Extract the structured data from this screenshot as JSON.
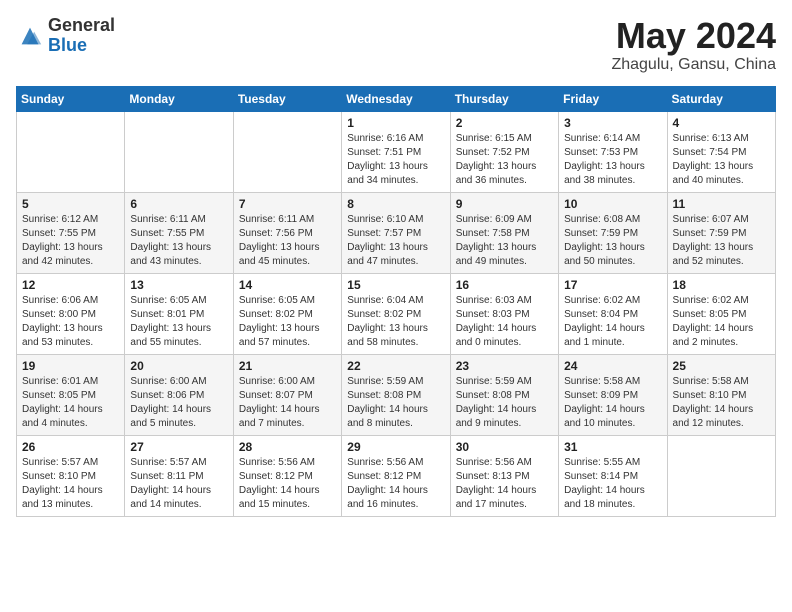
{
  "logo": {
    "general": "General",
    "blue": "Blue"
  },
  "title": {
    "month": "May 2024",
    "location": "Zhagulu, Gansu, China"
  },
  "weekdays": [
    "Sunday",
    "Monday",
    "Tuesday",
    "Wednesday",
    "Thursday",
    "Friday",
    "Saturday"
  ],
  "weeks": [
    [
      {
        "day": "",
        "info": ""
      },
      {
        "day": "",
        "info": ""
      },
      {
        "day": "",
        "info": ""
      },
      {
        "day": "1",
        "info": "Sunrise: 6:16 AM\nSunset: 7:51 PM\nDaylight: 13 hours\nand 34 minutes."
      },
      {
        "day": "2",
        "info": "Sunrise: 6:15 AM\nSunset: 7:52 PM\nDaylight: 13 hours\nand 36 minutes."
      },
      {
        "day": "3",
        "info": "Sunrise: 6:14 AM\nSunset: 7:53 PM\nDaylight: 13 hours\nand 38 minutes."
      },
      {
        "day": "4",
        "info": "Sunrise: 6:13 AM\nSunset: 7:54 PM\nDaylight: 13 hours\nand 40 minutes."
      }
    ],
    [
      {
        "day": "5",
        "info": "Sunrise: 6:12 AM\nSunset: 7:55 PM\nDaylight: 13 hours\nand 42 minutes."
      },
      {
        "day": "6",
        "info": "Sunrise: 6:11 AM\nSunset: 7:55 PM\nDaylight: 13 hours\nand 43 minutes."
      },
      {
        "day": "7",
        "info": "Sunrise: 6:11 AM\nSunset: 7:56 PM\nDaylight: 13 hours\nand 45 minutes."
      },
      {
        "day": "8",
        "info": "Sunrise: 6:10 AM\nSunset: 7:57 PM\nDaylight: 13 hours\nand 47 minutes."
      },
      {
        "day": "9",
        "info": "Sunrise: 6:09 AM\nSunset: 7:58 PM\nDaylight: 13 hours\nand 49 minutes."
      },
      {
        "day": "10",
        "info": "Sunrise: 6:08 AM\nSunset: 7:59 PM\nDaylight: 13 hours\nand 50 minutes."
      },
      {
        "day": "11",
        "info": "Sunrise: 6:07 AM\nSunset: 7:59 PM\nDaylight: 13 hours\nand 52 minutes."
      }
    ],
    [
      {
        "day": "12",
        "info": "Sunrise: 6:06 AM\nSunset: 8:00 PM\nDaylight: 13 hours\nand 53 minutes."
      },
      {
        "day": "13",
        "info": "Sunrise: 6:05 AM\nSunset: 8:01 PM\nDaylight: 13 hours\nand 55 minutes."
      },
      {
        "day": "14",
        "info": "Sunrise: 6:05 AM\nSunset: 8:02 PM\nDaylight: 13 hours\nand 57 minutes."
      },
      {
        "day": "15",
        "info": "Sunrise: 6:04 AM\nSunset: 8:02 PM\nDaylight: 13 hours\nand 58 minutes."
      },
      {
        "day": "16",
        "info": "Sunrise: 6:03 AM\nSunset: 8:03 PM\nDaylight: 14 hours\nand 0 minutes."
      },
      {
        "day": "17",
        "info": "Sunrise: 6:02 AM\nSunset: 8:04 PM\nDaylight: 14 hours\nand 1 minute."
      },
      {
        "day": "18",
        "info": "Sunrise: 6:02 AM\nSunset: 8:05 PM\nDaylight: 14 hours\nand 2 minutes."
      }
    ],
    [
      {
        "day": "19",
        "info": "Sunrise: 6:01 AM\nSunset: 8:05 PM\nDaylight: 14 hours\nand 4 minutes."
      },
      {
        "day": "20",
        "info": "Sunrise: 6:00 AM\nSunset: 8:06 PM\nDaylight: 14 hours\nand 5 minutes."
      },
      {
        "day": "21",
        "info": "Sunrise: 6:00 AM\nSunset: 8:07 PM\nDaylight: 14 hours\nand 7 minutes."
      },
      {
        "day": "22",
        "info": "Sunrise: 5:59 AM\nSunset: 8:08 PM\nDaylight: 14 hours\nand 8 minutes."
      },
      {
        "day": "23",
        "info": "Sunrise: 5:59 AM\nSunset: 8:08 PM\nDaylight: 14 hours\nand 9 minutes."
      },
      {
        "day": "24",
        "info": "Sunrise: 5:58 AM\nSunset: 8:09 PM\nDaylight: 14 hours\nand 10 minutes."
      },
      {
        "day": "25",
        "info": "Sunrise: 5:58 AM\nSunset: 8:10 PM\nDaylight: 14 hours\nand 12 minutes."
      }
    ],
    [
      {
        "day": "26",
        "info": "Sunrise: 5:57 AM\nSunset: 8:10 PM\nDaylight: 14 hours\nand 13 minutes."
      },
      {
        "day": "27",
        "info": "Sunrise: 5:57 AM\nSunset: 8:11 PM\nDaylight: 14 hours\nand 14 minutes."
      },
      {
        "day": "28",
        "info": "Sunrise: 5:56 AM\nSunset: 8:12 PM\nDaylight: 14 hours\nand 15 minutes."
      },
      {
        "day": "29",
        "info": "Sunrise: 5:56 AM\nSunset: 8:12 PM\nDaylight: 14 hours\nand 16 minutes."
      },
      {
        "day": "30",
        "info": "Sunrise: 5:56 AM\nSunset: 8:13 PM\nDaylight: 14 hours\nand 17 minutes."
      },
      {
        "day": "31",
        "info": "Sunrise: 5:55 AM\nSunset: 8:14 PM\nDaylight: 14 hours\nand 18 minutes."
      },
      {
        "day": "",
        "info": ""
      }
    ]
  ]
}
